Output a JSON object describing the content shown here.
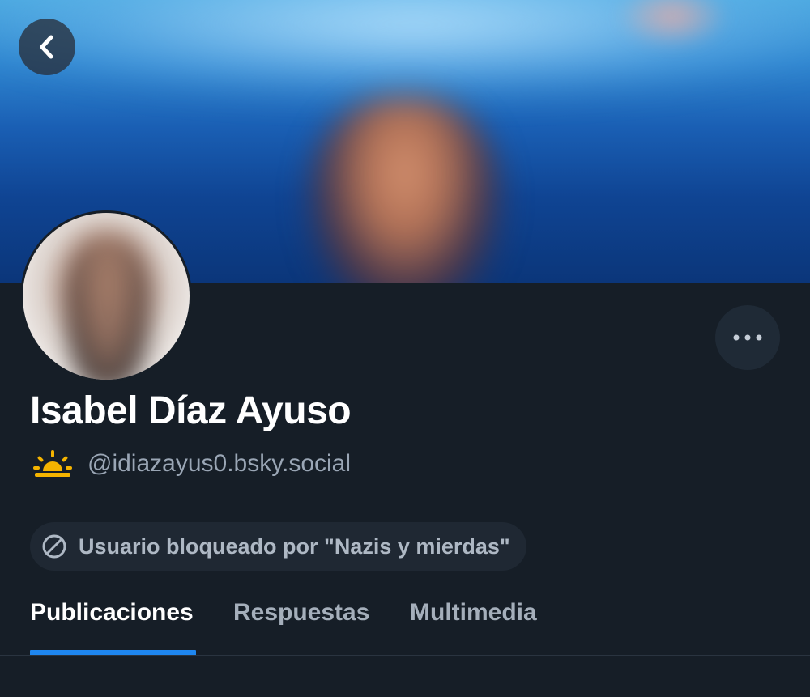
{
  "profile": {
    "display_name": "Isabel Díaz Ayuso",
    "handle": "@idiazayus0.bsky.social",
    "handle_icon": "sunrise-icon",
    "blocked_label": "Usuario bloqueado por \"Nazis y mierdas\"",
    "blocked_icon": "block-icon"
  },
  "header": {
    "back_icon": "chevron-left-icon",
    "more_icon": "ellipsis-icon"
  },
  "tabs": [
    {
      "label": "Publicaciones",
      "active": true
    },
    {
      "label": "Respuestas",
      "active": false
    },
    {
      "label": "Multimedia",
      "active": false
    }
  ],
  "colors": {
    "background": "#161e27",
    "accent": "#1e86ef",
    "sun": "#f5b400",
    "muted_text": "#9aa6b5"
  }
}
